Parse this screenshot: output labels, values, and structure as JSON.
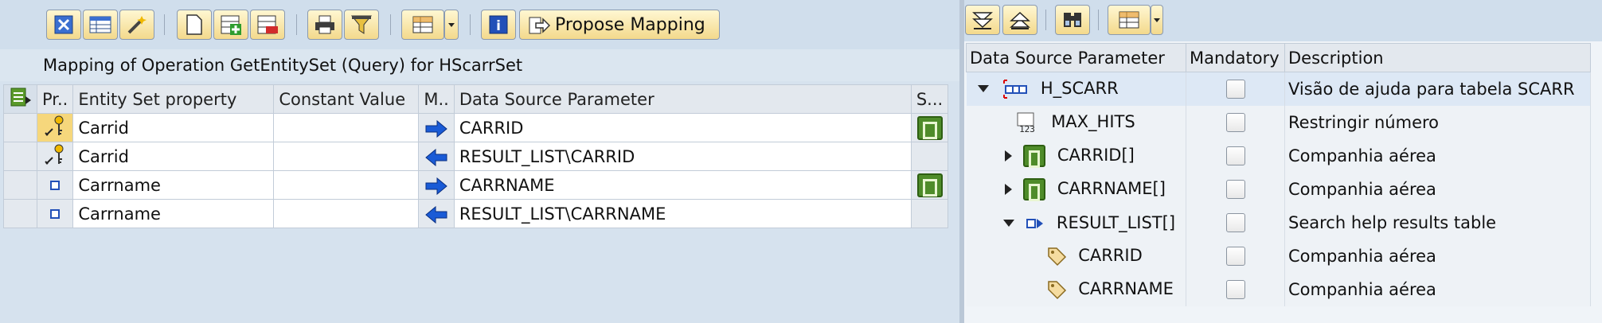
{
  "left_toolbar": {
    "propose_label": "Propose Mapping",
    "icons": [
      "close-icon",
      "table-view-icon",
      "magic-wand-icon",
      "new-document-icon",
      "add-row-icon",
      "delete-row-icon",
      "print-icon",
      "filter-icon",
      "layout-icon",
      "dropdown-arrow-icon",
      "info-icon",
      "propose-arrow-icon"
    ]
  },
  "caption": "Mapping of Operation GetEntitySet (Query) for HScarrSet",
  "left_table": {
    "headers": {
      "pr": "Pr..",
      "property": "Entity Set property",
      "constant": "Constant Value",
      "m": "M..",
      "source": "Data Source Parameter",
      "s": "S..."
    },
    "rows": [
      {
        "icon": "key-icon",
        "property": "Carrid",
        "constant": "",
        "direction": "right",
        "source": "CARRID",
        "status": "bracket"
      },
      {
        "icon": "key-icon",
        "property": "Carrid",
        "constant": "",
        "direction": "left",
        "source": "RESULT_LIST\\CARRID",
        "status": ""
      },
      {
        "icon": "field-icon",
        "property": "Carrname",
        "constant": "",
        "direction": "right",
        "source": "CARRNAME",
        "status": "bracket"
      },
      {
        "icon": "field-icon",
        "property": "Carrname",
        "constant": "",
        "direction": "left",
        "source": "RESULT_LIST\\CARRNAME",
        "status": ""
      }
    ]
  },
  "right_table": {
    "headers": {
      "param": "Data Source Parameter",
      "mandatory": "Mandatory",
      "description": "Description"
    },
    "rows": [
      {
        "indent": 0,
        "expander": "down",
        "icon": "structure-icon",
        "name": "H_SCARR",
        "mandatory": false,
        "description": "Visão de ajuda para tabela SCARR"
      },
      {
        "indent": 1,
        "expander": "",
        "icon": "number-icon",
        "name": "MAX_HITS",
        "mandatory": false,
        "description": "Restringir número"
      },
      {
        "indent": 1,
        "expander": "right",
        "icon": "bracket-icon",
        "name": "CARRID[]",
        "mandatory": false,
        "description": "Companhia aérea"
      },
      {
        "indent": 1,
        "expander": "right",
        "icon": "bracket-icon",
        "name": "CARRNAME[]",
        "mandatory": false,
        "description": "Companhia aérea"
      },
      {
        "indent": 1,
        "expander": "down",
        "icon": "table-icon",
        "name": "RESULT_LIST[]",
        "mandatory": false,
        "description": "Search help results table"
      },
      {
        "indent": 2,
        "expander": "",
        "icon": "tag-icon",
        "name": "CARRID",
        "mandatory": false,
        "description": "Companhia aérea"
      },
      {
        "indent": 2,
        "expander": "",
        "icon": "tag-icon",
        "name": "CARRNAME",
        "mandatory": false,
        "description": "Companhia aérea"
      }
    ]
  },
  "colors": {
    "toolbar_bg": "#d0deec",
    "button_grad": "#f3d98c",
    "arrow_blue": "#1a5bd6",
    "bracket_green": "#4f8c2a"
  }
}
